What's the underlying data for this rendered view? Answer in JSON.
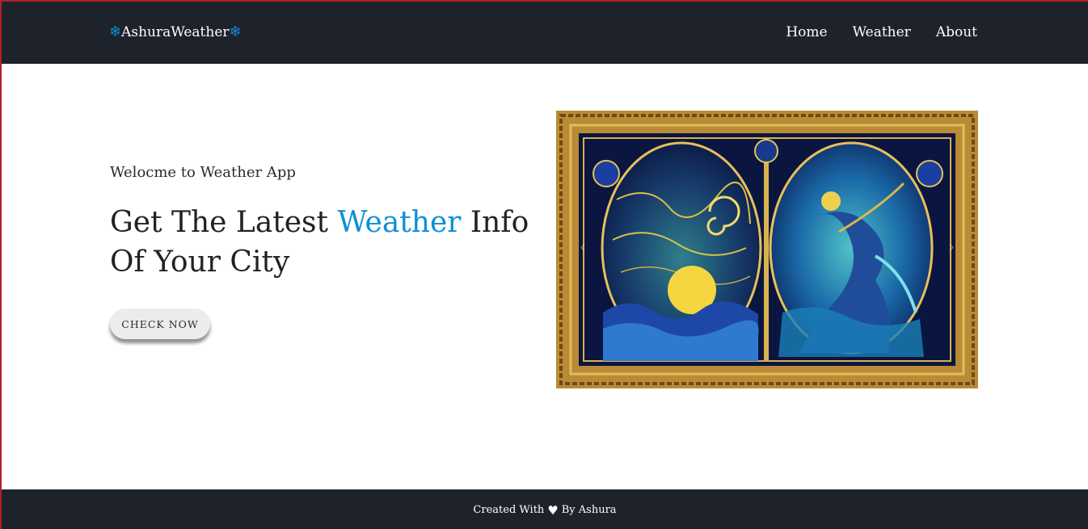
{
  "navbar": {
    "brand": "AshuraWeather",
    "brand_icon": "snowflake-icon",
    "links": [
      {
        "label": "Home"
      },
      {
        "label": "Weather"
      },
      {
        "label": "About"
      }
    ]
  },
  "hero": {
    "welcome": "Welocme to Weather App",
    "headline_before": "Get The Latest ",
    "headline_accent": "Weather",
    "headline_after": " Info Of Your City",
    "button_label": "CHECK NOW"
  },
  "carousel": {
    "prev_icon": "chevron-left-icon",
    "next_icon": "chevron-right-icon"
  },
  "footer": {
    "text_before": "Created With",
    "text_after": "By Ashura",
    "icon": "heart-icon"
  },
  "colors": {
    "navbar_bg": "#1e232b",
    "accent": "#0d8fd6",
    "button_bg": "#ececec"
  }
}
